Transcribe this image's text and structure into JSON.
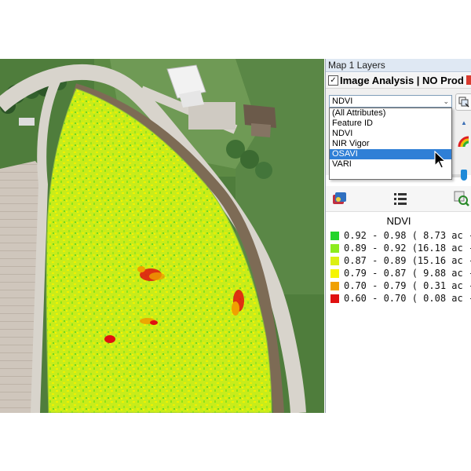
{
  "panel": {
    "title": "Map 1 Layers",
    "layer_label": "Image Analysis | NO Prod",
    "layer_checked_glyph": "✓",
    "attribute_select": {
      "value": "NDVI",
      "arrow_glyph": "⌄"
    },
    "attribute_options": [
      {
        "label": "(All Attributes)",
        "selected": false
      },
      {
        "label": "Feature ID",
        "selected": false
      },
      {
        "label": "NDVI",
        "selected": false
      },
      {
        "label": "NIR Vigor",
        "selected": false
      },
      {
        "label": "OSAVI",
        "selected": true
      },
      {
        "label": "VARI",
        "selected": false
      }
    ],
    "up_arrow_glyph": "▲",
    "accent_color": "#2f7fd6"
  },
  "legend": {
    "title": "NDVI",
    "rows": [
      {
        "text": "0.92 - 0.98 ( 8.73 ac -",
        "color": "#22d42a"
      },
      {
        "text": "0.89 - 0.92 (16.18 ac -",
        "color": "#8cec1e"
      },
      {
        "text": "0.87 - 0.89 (15.16 ac -",
        "color": "#dcf014"
      },
      {
        "text": "0.79 - 0.87 ( 9.88 ac -",
        "color": "#f5f500"
      },
      {
        "text": "0.70 - 0.79 ( 0.31 ac -",
        "color": "#f0a000"
      },
      {
        "text": "0.60 - 0.70 ( 0.08 ac -",
        "color": "#e01010"
      }
    ]
  },
  "icons": [
    "copy-layer-icon",
    "mouse-pointer-icon",
    "color-ramp-icon",
    "palette-icon",
    "list-icon",
    "zoom-search-icon"
  ]
}
